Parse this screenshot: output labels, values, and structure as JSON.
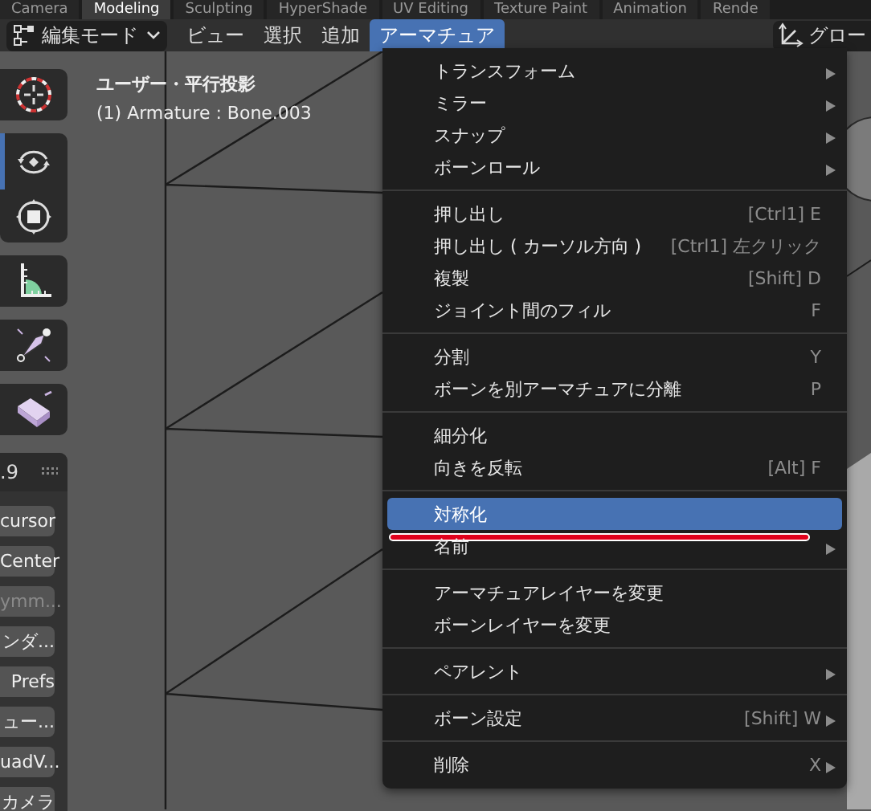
{
  "workspace_tabs": [
    {
      "label": "Camera",
      "selected": false
    },
    {
      "label": "Modeling",
      "selected": true
    },
    {
      "label": "Sculpting",
      "selected": false
    },
    {
      "label": "HyperShade",
      "selected": false
    },
    {
      "label": "UV Editing",
      "selected": false
    },
    {
      "label": "Texture Paint",
      "selected": false
    },
    {
      "label": "Animation",
      "selected": false
    },
    {
      "label": "Rende",
      "selected": false
    }
  ],
  "header": {
    "mode": "編集モード",
    "menus": [
      {
        "label": "ビュー",
        "selected": false
      },
      {
        "label": "選択",
        "selected": false
      },
      {
        "label": "追加",
        "selected": false
      },
      {
        "label": "アーマチュア",
        "selected": true
      }
    ],
    "orientation": "グロー"
  },
  "viewport": {
    "view_name": "ユーザー・平行投影",
    "object_info": "(1) Armature : Bone.003"
  },
  "tools": [
    {
      "kind": "cursor",
      "selected": false
    },
    {
      "kind": "rotate",
      "selected": true
    },
    {
      "kind": "scale",
      "selected": false
    },
    {
      "kind": "measure",
      "selected": false
    },
    {
      "kind": "bone",
      "selected": false
    },
    {
      "kind": "extrude",
      "selected": false
    }
  ],
  "side_panel": {
    "title": ".9",
    "buttons": [
      {
        "label": "cursor",
        "disabled": false
      },
      {
        "label": "Center",
        "disabled": false
      },
      {
        "label": "ymm...",
        "disabled": true
      },
      {
        "label": "ンダ...",
        "disabled": false
      },
      {
        "label": "Prefs",
        "disabled": false
      },
      {
        "label": "ュー...",
        "disabled": false
      },
      {
        "label": "uadV...",
        "disabled": false
      },
      {
        "label": "カメラ",
        "disabled": false
      }
    ]
  },
  "menu": {
    "groups": [
      {
        "items": [
          {
            "label": "トランスフォーム",
            "submenu": true,
            "selected": false,
            "underlined": false
          },
          {
            "label": "ミラー",
            "submenu": true,
            "selected": false,
            "underlined": false
          },
          {
            "label": "スナップ",
            "submenu": true,
            "selected": false,
            "underlined": false
          },
          {
            "label": "ボーンロール",
            "submenu": true,
            "selected": false,
            "underlined": false
          }
        ]
      },
      {
        "items": [
          {
            "label": "押し出し",
            "shortcut": "[Ctrl1] E",
            "submenu": false,
            "selected": false,
            "underlined": false
          },
          {
            "label": "押し出し ( カーソル方向 )",
            "shortcut": "[Ctrl1] 左クリック",
            "submenu": false,
            "selected": false,
            "underlined": false
          },
          {
            "label": "複製",
            "shortcut": "[Shift] D",
            "submenu": false,
            "selected": false,
            "underlined": false
          },
          {
            "label": "ジョイント間のフィル",
            "shortcut": "F",
            "submenu": false,
            "selected": false,
            "underlined": false
          }
        ]
      },
      {
        "items": [
          {
            "label": "分割",
            "shortcut": "Y",
            "submenu": false,
            "selected": false,
            "underlined": false
          },
          {
            "label": "ボーンを別アーマチュアに分離",
            "shortcut": "P",
            "submenu": false,
            "selected": false,
            "underlined": false
          }
        ]
      },
      {
        "items": [
          {
            "label": "細分化",
            "submenu": false,
            "selected": false,
            "underlined": false
          },
          {
            "label": "向きを反転",
            "shortcut": "[Alt] F",
            "submenu": false,
            "selected": false,
            "underlined": false
          }
        ]
      },
      {
        "items": [
          {
            "label": "対称化",
            "submenu": false,
            "selected": true,
            "underlined": true
          },
          {
            "label": "名前",
            "submenu": true,
            "selected": false,
            "underlined": false
          }
        ]
      },
      {
        "items": [
          {
            "label": "アーマチュアレイヤーを変更",
            "submenu": false,
            "selected": false,
            "underlined": false
          },
          {
            "label": "ボーンレイヤーを変更",
            "submenu": false,
            "selected": false,
            "underlined": false
          }
        ]
      },
      {
        "items": [
          {
            "label": "ペアレント",
            "submenu": true,
            "selected": false,
            "underlined": false
          }
        ]
      },
      {
        "items": [
          {
            "label": "ボーン設定",
            "shortcut": "[Shift] W",
            "submenu": true,
            "selected": false,
            "underlined": false
          }
        ]
      },
      {
        "items": [
          {
            "label": "削除",
            "shortcut": "X",
            "submenu": true,
            "selected": false,
            "underlined": false
          }
        ]
      }
    ]
  }
}
